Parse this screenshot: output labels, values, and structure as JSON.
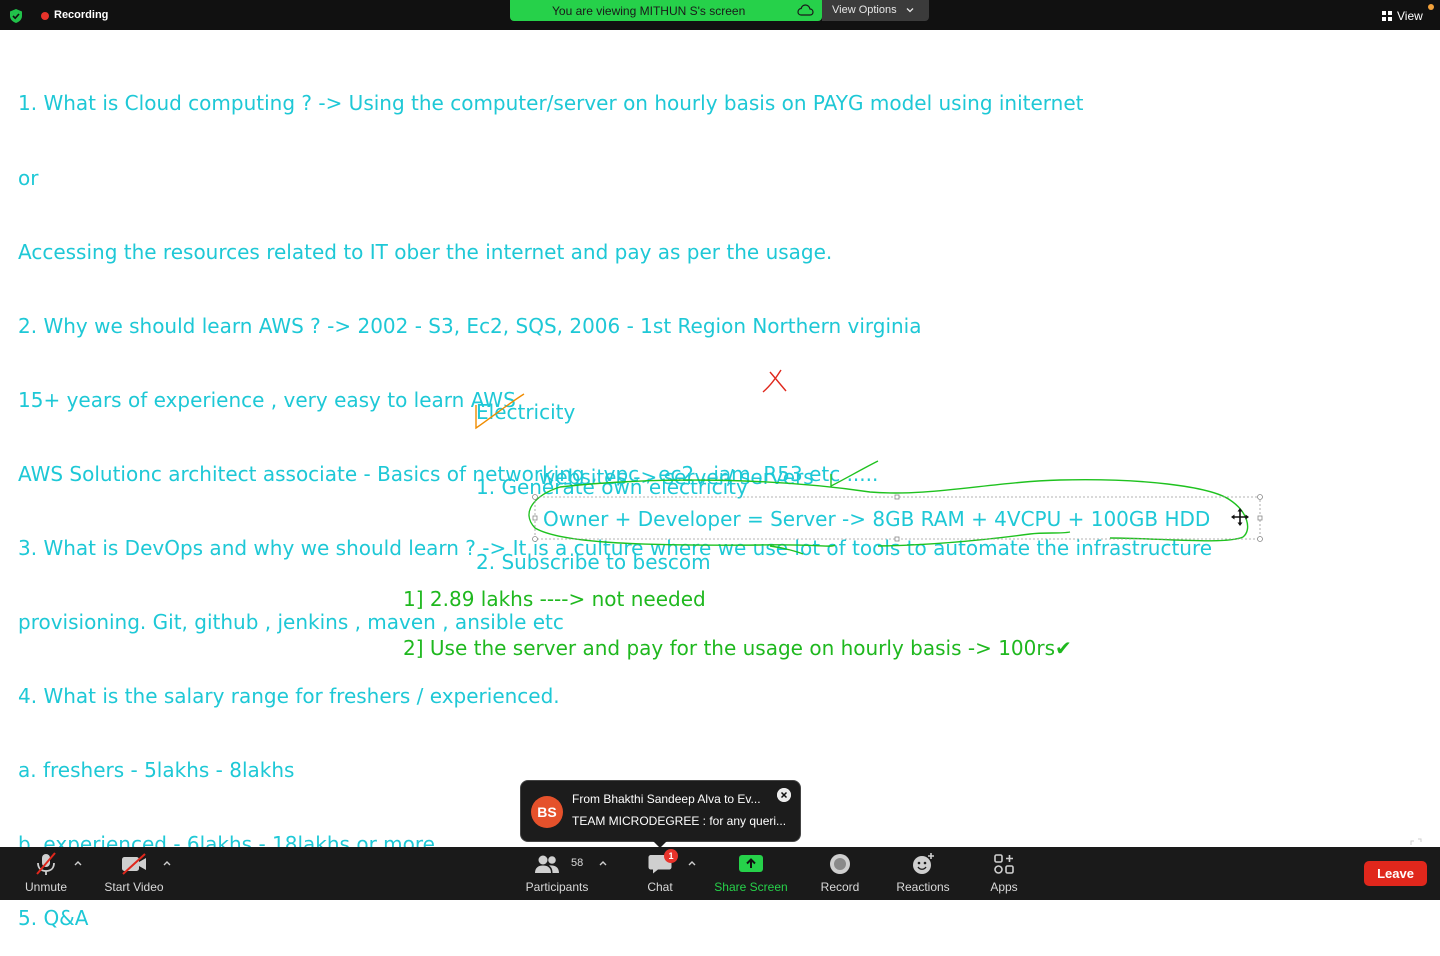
{
  "topbar": {
    "recording_label": "Recording",
    "viewing_banner": "You are viewing MITHUN S's screen",
    "view_options": "View Options",
    "view_label": "View"
  },
  "notes": {
    "lines": [
      "1. What is Cloud computing ? -> Using the computer/server on hourly basis on PAYG model using initernet",
      "or",
      "Accessing the resources related to IT ober the internet and pay as per the usage.",
      "2. Why we should learn AWS ? -> 2002 - S3, Ec2, SQS, 2006 - 1st Region Northern virginia",
      "15+ years of experience , very easy to learn AWS",
      "AWS Solutionc architect associate - Basics of networking , vpc , ec2 , iam ,R53 etc .....",
      "3. What is DevOps and why we should learn ? -> It is a culture where we use lot of tools to automate the infrastructure",
      "provisioning. Git, github , jenkins , maven , ansible etc",
      "4. What is the salary range for freshers / experienced.",
      "a. freshers - 5lakhs - 8lakhs",
      "b. experienced - 6lakhs - 18lakhs or more",
      "5. Q&A"
    ],
    "electricity": {
      "title": "Electricity",
      "item1": "1. Generate own electricity",
      "item2": "2. Subscribe to bescom"
    },
    "websites_line": "websites -> server/ servers",
    "owner_line": "Owner + Developer = Server -> 8GB RAM + 4VCPU + 100GB HDD",
    "option1": "1] 2.89 lakhs ----> not needed",
    "option2": "2] Use the server and pay for the usage on hourly basis -> 100rs",
    "option2_check": "✔",
    "colors": {
      "note_text": "#1ec8d6",
      "green_text": "#1fb81f",
      "annotation_red": "#e0271c",
      "annotation_orange": "#f08c00",
      "annotation_green": "#1fc21f"
    }
  },
  "chat_popup": {
    "avatar_initials": "BS",
    "from": "From Bhakthi Sandeep Alva to Ev...",
    "message": "TEAM MICRODEGREE : for any queri..."
  },
  "toolbar": {
    "unmute": "Unmute",
    "start_video": "Start Video",
    "participants": "Participants",
    "participants_count": "58",
    "chat": "Chat",
    "chat_badge": "1",
    "share_screen": "Share Screen",
    "record": "Record",
    "reactions": "Reactions",
    "apps": "Apps",
    "leave": "Leave"
  }
}
